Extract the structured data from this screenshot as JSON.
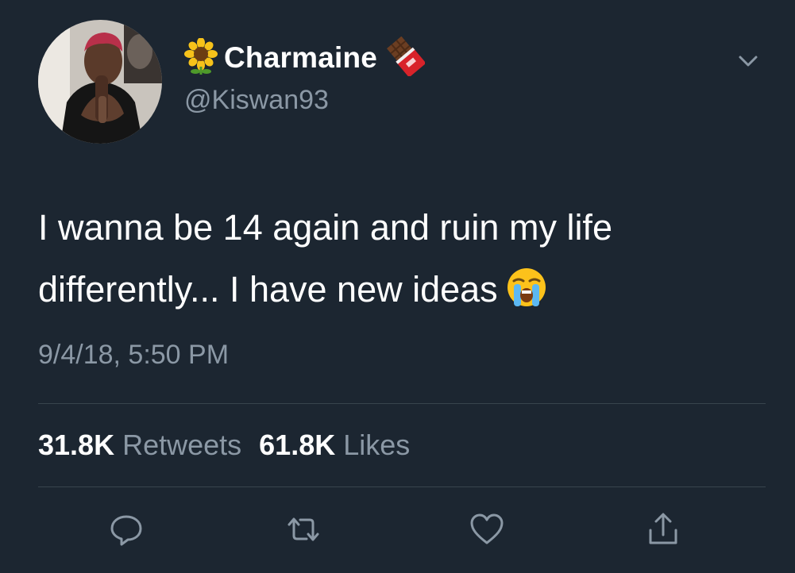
{
  "user": {
    "display_name": "Charmaine",
    "handle": "@Kiswan93",
    "name_prefix_emoji": "sunflower-icon",
    "name_suffix_emoji": "chocolate-bar-icon"
  },
  "tweet": {
    "text_lines": [
      "I wanna be 14 again and ruin my life",
      "differently... I have new ideas"
    ],
    "trailing_emoji": "loudly-crying-face-icon",
    "timestamp": "9/4/18, 5:50 PM"
  },
  "stats": {
    "retweets_count": "31.8K",
    "retweets_label": "Retweets",
    "likes_count": "61.8K",
    "likes_label": "Likes"
  },
  "actions": [
    "reply-icon",
    "retweet-icon",
    "like-icon",
    "share-icon"
  ],
  "colors": {
    "background": "#1c2631",
    "primary_text": "#ffffff",
    "secondary_text": "#8b98a5",
    "divider": "#38444d"
  }
}
